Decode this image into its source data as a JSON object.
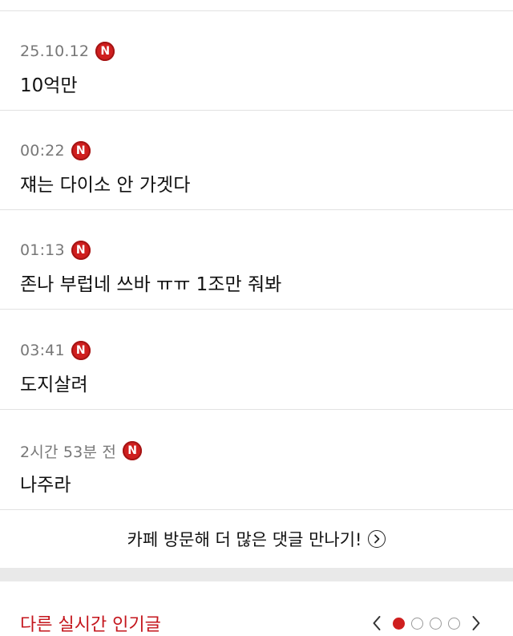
{
  "comments": [
    {
      "time": "25.10.12",
      "badge": "N",
      "text": "10억만"
    },
    {
      "time": "00:22",
      "badge": "N",
      "text": "쟤는 다이소 안 가겟다"
    },
    {
      "time": "01:13",
      "badge": "N",
      "text": "존나 부럽네 쓰바 ㅠㅠ 1조만 줘봐"
    },
    {
      "time": "03:41",
      "badge": "N",
      "text": "도지살려"
    },
    {
      "time": "2시간 53분 전",
      "badge": "N",
      "text": "나주라"
    }
  ],
  "more_link": {
    "label": "카페 방문해 더 많은 댓글 만나기!",
    "icon": "chevron-right-circle-icon"
  },
  "popular": {
    "title": "다른 실시간 인기글",
    "pagination": {
      "total": 4,
      "current": 1
    },
    "prev_icon": "chevron-left-icon",
    "next_icon": "chevron-right-icon"
  },
  "colors": {
    "accent": "#cf1e1e",
    "title_red": "#c4151c",
    "meta_gray": "#777777",
    "divider": "#e2e2e2",
    "band": "#e9e9e9"
  }
}
